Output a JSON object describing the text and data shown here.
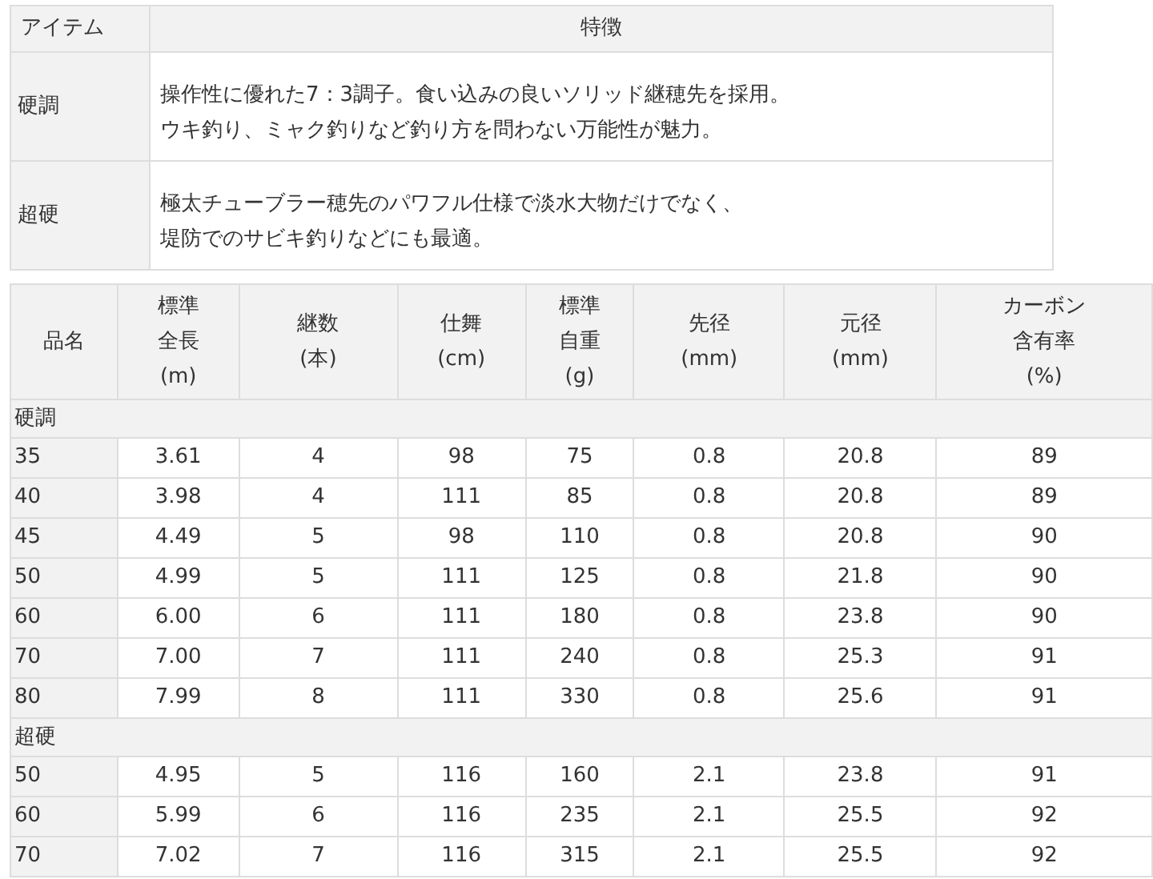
{
  "feature_table": {
    "columns": [
      "アイテム",
      "特徴"
    ],
    "rows": [
      {
        "item": "硬調",
        "lines": [
          "操作性に優れた7：3調子。食い込みの良いソリッド継穂先を採用。",
          "ウキ釣り、ミャク釣りなど釣り方を問わない万能性が魅力。"
        ]
      },
      {
        "item": "超硬",
        "lines": [
          "極太チューブラー穂先のパワフル仕様で淡水大物だけでなく、",
          "堤防でのサビキ釣りなどにも最適。"
        ]
      }
    ]
  },
  "spec_table": {
    "columns": [
      [
        "品名"
      ],
      [
        "標準",
        "全長",
        "(m)"
      ],
      [
        "継数",
        "(本)"
      ],
      [
        "仕舞",
        "(cm)"
      ],
      [
        "標準",
        "自重",
        "(g)"
      ],
      [
        "先径",
        "(mm)"
      ],
      [
        "元径",
        "(mm)"
      ],
      [
        "カーボン",
        "含有率",
        "(%)"
      ]
    ],
    "groups": [
      {
        "title": "硬調",
        "rows": [
          [
            "35",
            "3.61",
            "4",
            "98",
            "75",
            "0.8",
            "20.8",
            "89"
          ],
          [
            "40",
            "3.98",
            "4",
            "111",
            "85",
            "0.8",
            "20.8",
            "89"
          ],
          [
            "45",
            "4.49",
            "5",
            "98",
            "110",
            "0.8",
            "20.8",
            "90"
          ],
          [
            "50",
            "4.99",
            "5",
            "111",
            "125",
            "0.8",
            "21.8",
            "90"
          ],
          [
            "60",
            "6.00",
            "6",
            "111",
            "180",
            "0.8",
            "23.8",
            "90"
          ],
          [
            "70",
            "7.00",
            "7",
            "111",
            "240",
            "0.8",
            "25.3",
            "91"
          ],
          [
            "80",
            "7.99",
            "8",
            "111",
            "330",
            "0.8",
            "25.6",
            "91"
          ]
        ]
      },
      {
        "title": "超硬",
        "rows": [
          [
            "50",
            "4.95",
            "5",
            "116",
            "160",
            "2.1",
            "23.8",
            "91"
          ],
          [
            "60",
            "5.99",
            "6",
            "116",
            "235",
            "2.1",
            "25.5",
            "92"
          ],
          [
            "70",
            "7.02",
            "7",
            "116",
            "315",
            "2.1",
            "25.5",
            "92"
          ]
        ]
      }
    ]
  }
}
